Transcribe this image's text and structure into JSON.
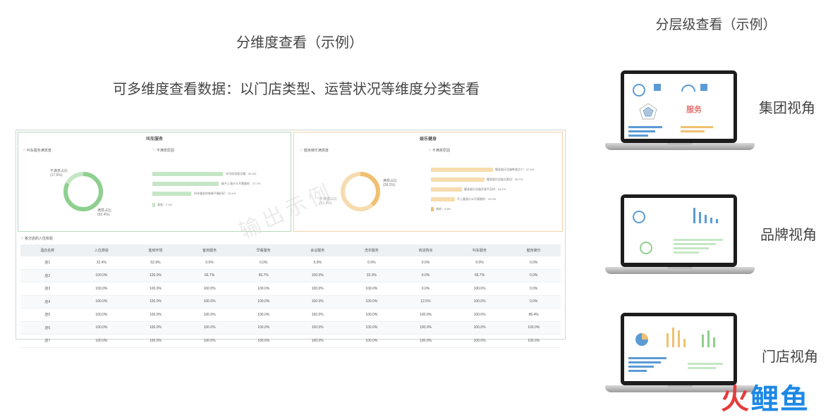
{
  "titles": {
    "main": "分维度查看（示例）",
    "subtitle": "可多维度查看数据：以门店类型、运营状况等维度分类查看",
    "right": "分层级查看（示例）"
  },
  "dashboard": {
    "watermark": "输出示例",
    "panel_left": {
      "title": "叫车服务",
      "donut_label": "♡ 叫车服务满意度",
      "bars_label": "♡ 不满意原因",
      "ring_top": "不满意占比",
      "ring_top_pct": "(17.6%)",
      "ring_bottom": "满意占比",
      "ring_bottom_pct": "(82.4%)",
      "bars": [
        {
          "label": "车司机语速太慢：40.0%",
          "value": 40.0
        },
        {
          "label": "能不上乘什么不满意的：37.7%",
          "value": 37.7
        },
        {
          "label": "叫车服务的效果不够好好：22.1%",
          "value": 22.1
        }
      ],
      "legend": "其他：2.1%"
    },
    "panel_right": {
      "title": "娱乐健身",
      "donut_label": "♡ 健身娱乐满意度",
      "bars_label": "♡ 不满意原因",
      "ring_top": "满意占比",
      "ring_top_pct": "(38.2%)",
      "ring_left": "不满意占比",
      "ring_left_pct": "(61.8%)",
      "bars": [
        {
          "label": "健身娱乐设施种类太少：47.0%",
          "value": 47.0
        },
        {
          "label": "健身娱乐设施太陈旧：40.7%",
          "value": 40.7
        },
        {
          "label": "健身娱乐设施开放不及时：26.1%",
          "value": 26.1
        },
        {
          "label": "不上健身什么不满意的：20.0%",
          "value": 20.0
        }
      ],
      "legend": "其他：3.5%"
    },
    "table_title": "♡ 各分店的入住体验",
    "table": {
      "headers": [
        "酒店名称",
        "入住感受",
        "客房环境",
        "客房服务",
        "早餐服务",
        "会议服务",
        "洗衣服务",
        "商店购买",
        "叫车服务",
        "健身娱乐"
      ],
      "rows": [
        [
          "店1",
          "32.4%",
          "52.9%",
          "0.0%",
          "0.0%",
          "5.9%",
          "0.0%",
          "0.0%",
          "0.0%",
          "0.0%"
        ],
        [
          "店2",
          "100.0%",
          "100.0%",
          "66.7%",
          "66.7%",
          "100.0%",
          "33.3%",
          "0.0%",
          "66.7%",
          "0.0%"
        ],
        [
          "店3",
          "100.0%",
          "100.0%",
          "100.0%",
          "100.0%",
          "100.0%",
          "100.0%",
          "0.0%",
          "100.0%",
          "0.0%"
        ],
        [
          "店4",
          "100.0%",
          "100.0%",
          "100.0%",
          "100.0%",
          "100.0%",
          "100.0%",
          "12.5%",
          "100.0%",
          "0.0%"
        ],
        [
          "店5",
          "100.0%",
          "100.0%",
          "100.0%",
          "100.0%",
          "100.0%",
          "100.0%",
          "100.0%",
          "100.0%",
          "86.4%"
        ],
        [
          "店6",
          "100.0%",
          "100.0%",
          "100.0%",
          "100.0%",
          "100.0%",
          "100.0%",
          "100.0%",
          "100.0%",
          "100.0%"
        ],
        [
          "店7",
          "100.0%",
          "100.0%",
          "100.0%",
          "100.0%",
          "100.0%",
          "100.0%",
          "100.0%",
          "100.0%",
          "100.0%"
        ]
      ]
    }
  },
  "laptops": [
    {
      "label": "集团视角",
      "word_cloud": "服务"
    },
    {
      "label": "品牌视角"
    },
    {
      "label": "门店视角"
    }
  ],
  "brand_mark": "火鲤鱼",
  "colors": {
    "green": "#8fcf8f",
    "green_light": "#c5e6c5",
    "orange": "#f0c070",
    "orange_light": "#f6dcae",
    "blue": "#5b9bd5",
    "brand_red": "#e63b3b",
    "brand_blue": "#1e88e5"
  }
}
